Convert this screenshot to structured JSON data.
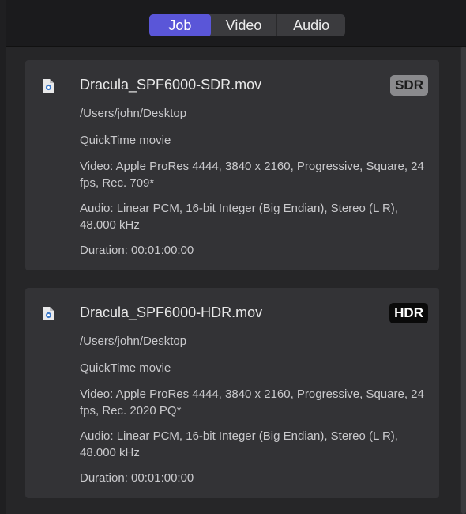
{
  "tabs": [
    {
      "label": "Job",
      "active": true
    },
    {
      "label": "Video",
      "active": false
    },
    {
      "label": "Audio",
      "active": false
    }
  ],
  "files": [
    {
      "name": "Dracula_SPF6000-SDR.mov",
      "badge": "SDR",
      "path": "/Users/john/Desktop",
      "kind": "QuickTime movie",
      "video": "Video: Apple ProRes 4444, 3840 x 2160, Progressive, Square, 24 fps, Rec. 709*",
      "audio": "Audio: Linear PCM, 16-bit Integer (Big Endian), Stereo (L R), 48.000 kHz",
      "duration": "Duration: 00:01:00:00",
      "icon": "quicktime-file-icon"
    },
    {
      "name": "Dracula_SPF6000-HDR.mov",
      "badge": "HDR",
      "path": "/Users/john/Desktop",
      "kind": "QuickTime movie",
      "video": "Video: Apple ProRes 4444, 3840 x 2160, Progressive, Square, 24 fps, Rec. 2020 PQ*",
      "audio": "Audio: Linear PCM, 16-bit Integer (Big Endian), Stereo (L R), 48.000 kHz",
      "duration": "Duration: 00:01:00:00",
      "icon": "quicktime-file-icon"
    }
  ],
  "colors": {
    "accent": "#5a56d8",
    "sdr_badge": "#8a8a8d",
    "hdr_badge": "#0a0a0a"
  }
}
